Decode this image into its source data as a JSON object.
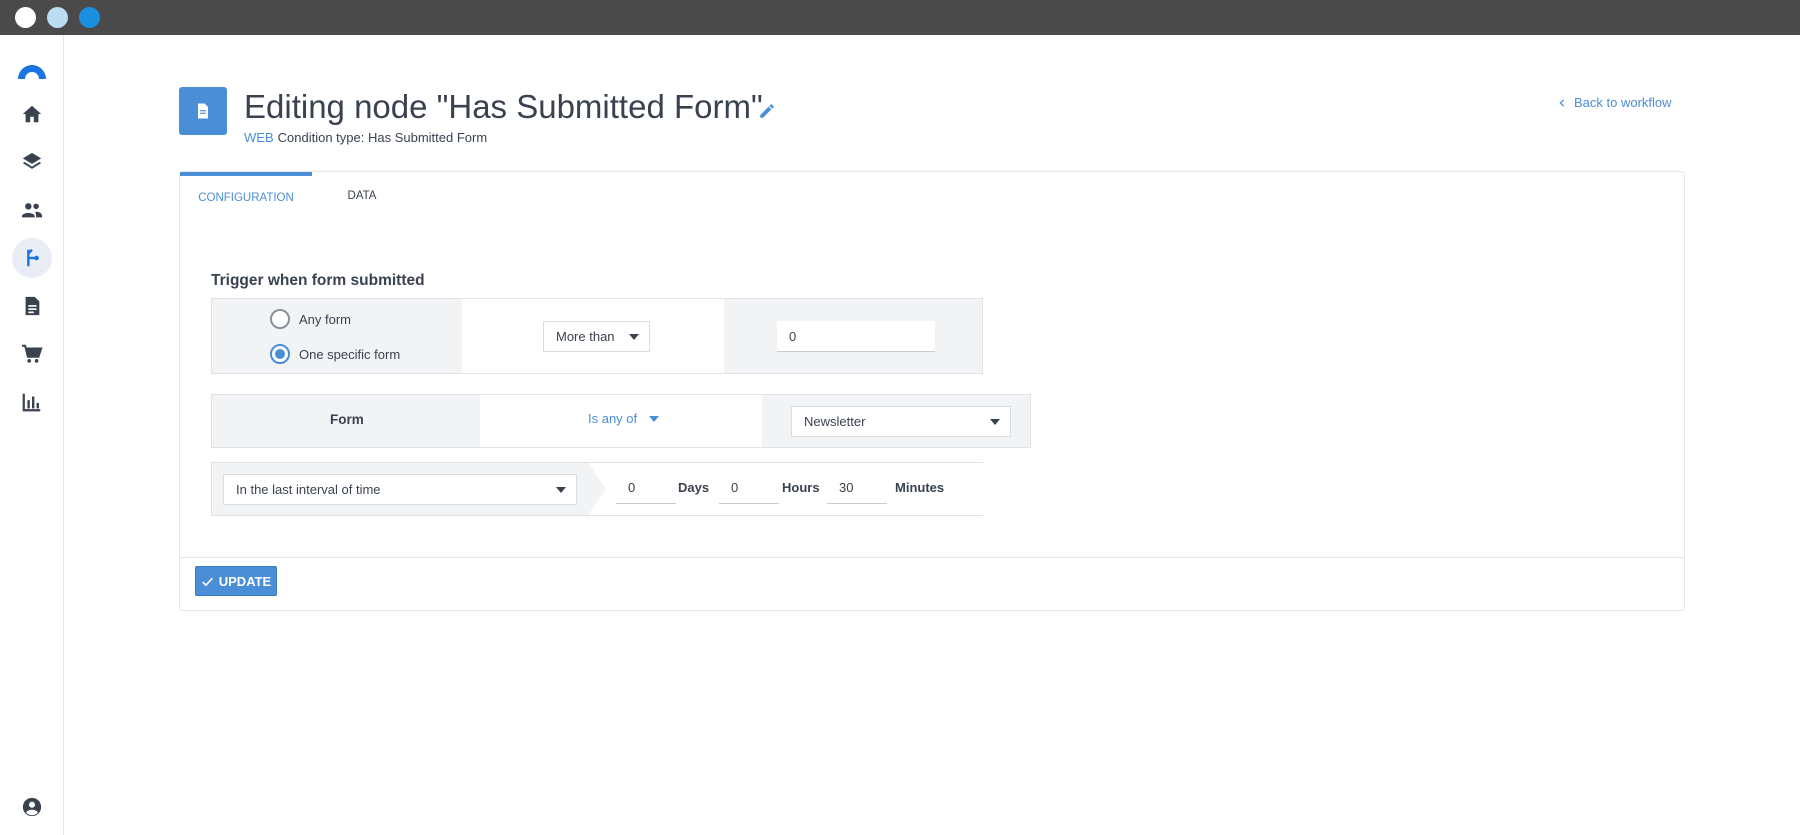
{
  "window": {
    "controls": [
      "close-icon",
      "minimize-icon",
      "maximize-icon"
    ]
  },
  "sidebar": {
    "items": [
      {
        "name": "home-icon"
      },
      {
        "name": "layers-icon"
      },
      {
        "name": "people-icon"
      },
      {
        "name": "workflow-icon",
        "active": true
      },
      {
        "name": "document-icon"
      },
      {
        "name": "cart-icon"
      },
      {
        "name": "bar-chart-icon"
      }
    ],
    "bottom_icon": "account-icon"
  },
  "header": {
    "title": "Editing node \"Has Submitted Form\"",
    "tag": "WEB",
    "condition_text": "Condition type: Has Submitted Form",
    "back_label": "Back to workflow"
  },
  "tabs": [
    {
      "label": "CONFIGURATION",
      "active": true
    },
    {
      "label": "DATA",
      "active": false
    }
  ],
  "config": {
    "section_title": "Trigger when form submitted",
    "radio_any": "Any form",
    "radio_specific": "One specific form",
    "selected_radio": "specific",
    "count_operator": "More than",
    "count_value": "0",
    "form_label": "Form",
    "form_operator": "Is any of",
    "form_value": "Newsletter",
    "interval_mode": "In the last interval of time",
    "days_value": "0",
    "days_label": "Days",
    "hours_value": "0",
    "hours_label": "Hours",
    "minutes_value": "30",
    "minutes_label": "Minutes"
  },
  "footer": {
    "update_label": "UPDATE"
  },
  "colors": {
    "accent": "#4a8ed6",
    "titlebar": "#4a4a4a"
  }
}
